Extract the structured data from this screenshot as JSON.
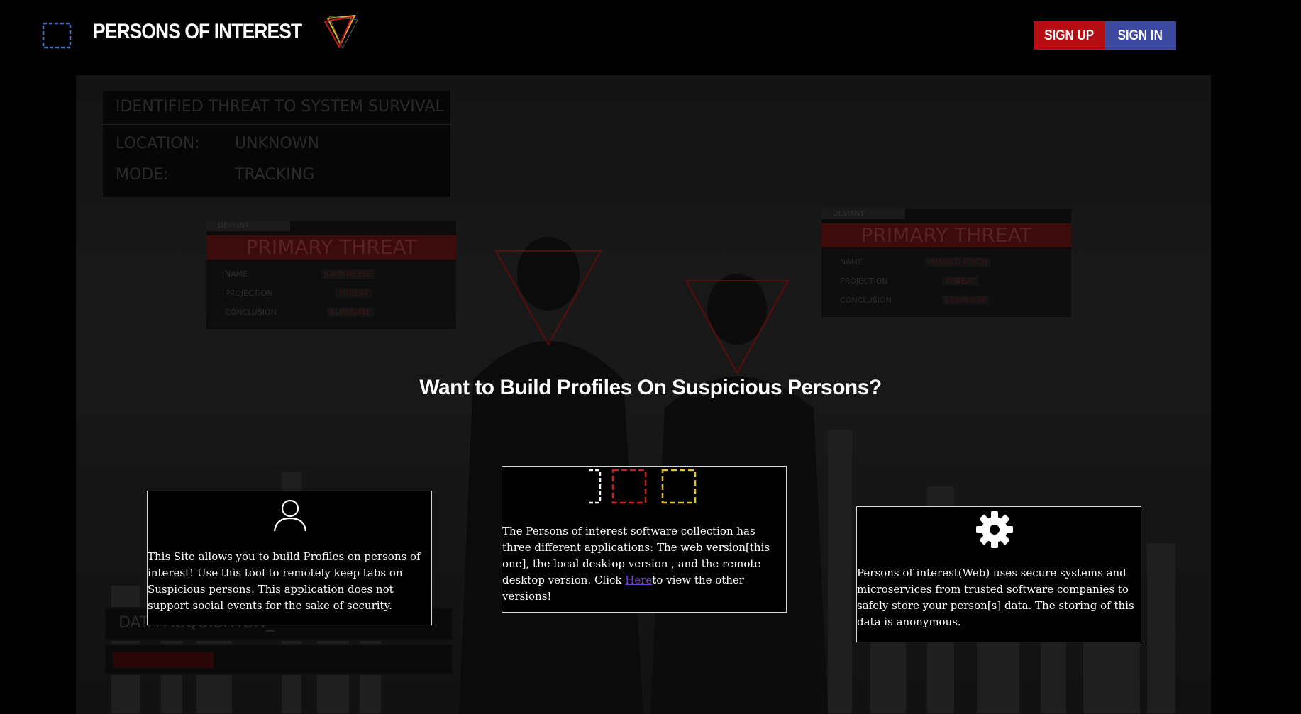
{
  "header": {
    "brand": "PERSONS OF INTEREST",
    "logo_icon": "bracket-square-icon",
    "accent_icon": "inverted-triangle-icon",
    "sign_up_label": "SIGN UP",
    "sign_in_label": "SIGN IN",
    "colors": {
      "sign_up": "#b50e14",
      "sign_in": "#3e4a9f"
    }
  },
  "background": {
    "threat_panel": {
      "title": "IDENTIFIED THREAT TO SYSTEM SURVIVAL",
      "rows": [
        {
          "label": "LOCATION:",
          "value": "UNKNOWN"
        },
        {
          "label": "MODE:",
          "value": "TRACKING"
        }
      ]
    },
    "profile_cards": [
      {
        "tag": "DEVIANT",
        "heading": "PRIMARY THREAT",
        "lines": [
          {
            "label": "NAME",
            "value": "JOHN REESE"
          },
          {
            "label": "PROJECTION",
            "value": "THREAT"
          },
          {
            "label": "CONCLUSION",
            "value": "ELIMINATE"
          }
        ]
      },
      {
        "tag": "DEVIANT",
        "heading": "PRIMARY THREAT",
        "lines": [
          {
            "label": "NAME",
            "value": "HAROLD FINCH"
          },
          {
            "label": "PROJECTION",
            "value": "THREAT"
          },
          {
            "label": "CONCLUSION",
            "value": "ELIMINATE"
          }
        ]
      }
    ],
    "data_acquisition": {
      "label": "DATA ACQUISITION_",
      "progress": 0.3
    }
  },
  "main": {
    "headline": "Want to Build Profiles On Suspicious Persons?",
    "cards": [
      {
        "icon": "user-outline-icon",
        "text": "This Site allows you to build Profiles on persons of interest! Use this tool to remotely keep tabs on Suspicious persons. This application does not support social events for the sake of security."
      },
      {
        "icon": "app-versions-icons",
        "text_before": "The Persons of interest software collection has three different applications: The web version[this one], the local desktop version , and the remote desktop version. Click ",
        "link_label": "Here",
        "text_after": "to view the other versions!"
      },
      {
        "icon": "gear-icon",
        "text": "Persons of interest(Web) uses secure systems and microservices from trusted software companies to safely store your person[s] data. The storing of this data is anonymous."
      }
    ]
  }
}
